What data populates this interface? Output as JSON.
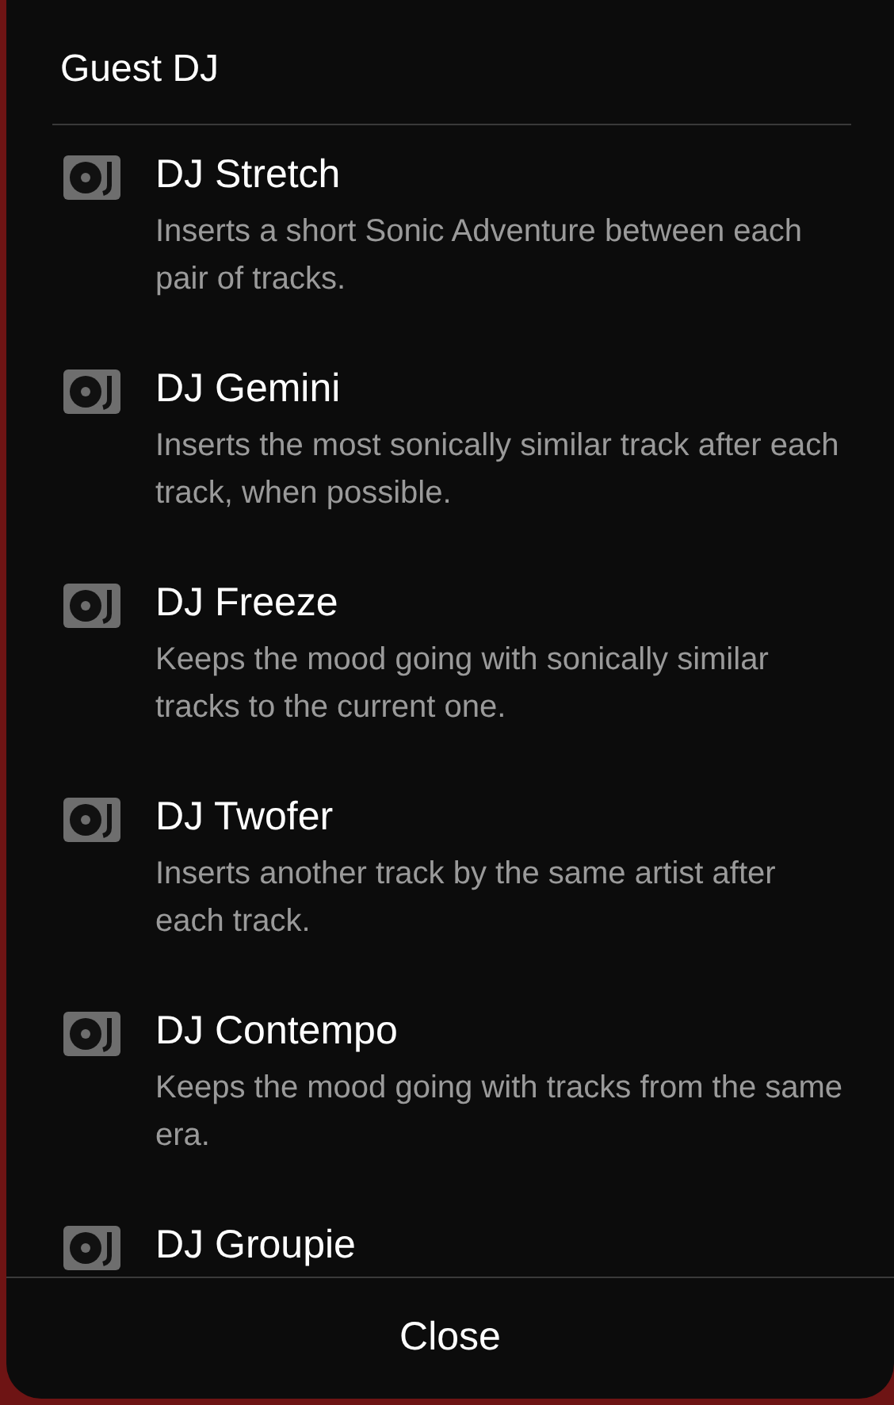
{
  "title": "Guest DJ",
  "items": [
    {
      "name": "DJ Stretch",
      "description": "Inserts a short Sonic Adventure between each pair of tracks."
    },
    {
      "name": "DJ Gemini",
      "description": "Inserts the most sonically similar track after each track, when possible."
    },
    {
      "name": "DJ Freeze",
      "description": "Keeps the mood going with sonically similar tracks to the current one."
    },
    {
      "name": "DJ Twofer",
      "description": "Inserts another track by the same artist after each track."
    },
    {
      "name": "DJ Contempo",
      "description": "Keeps the mood going with tracks from the same era."
    },
    {
      "name": "DJ Groupie"
    }
  ],
  "close_button": "Close"
}
